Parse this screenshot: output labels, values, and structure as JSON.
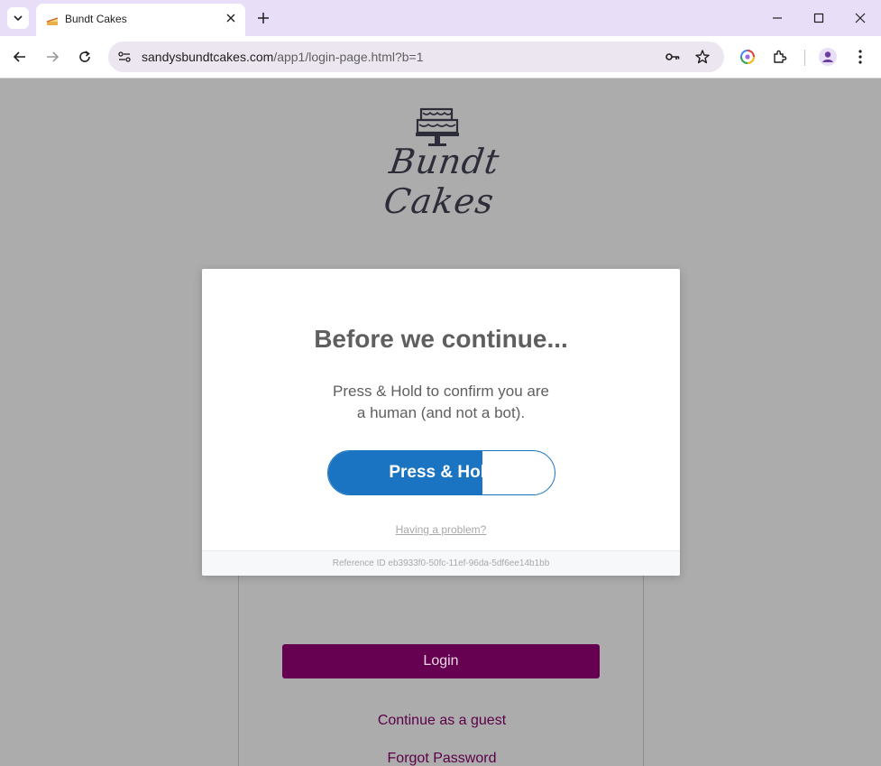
{
  "browser": {
    "tab": {
      "title": "Bundt Cakes"
    },
    "url": {
      "host": "sandysbundtcakes.com",
      "path": "/app1/login-page.html?b=1"
    }
  },
  "page": {
    "logo_text": "Bundt Cakes",
    "login_button": "Login",
    "guest_link": "Continue as a guest",
    "forgot_link": "Forgot Password"
  },
  "modal": {
    "title": "Before we continue...",
    "description_line1": "Press & Hold to confirm you are",
    "description_line2": "a human (and not a bot).",
    "hold_button": "Press & Hold",
    "hold_progress": 0.68,
    "problem_link": "Having a problem?",
    "reference": "Reference ID eb3933f0-50fc-11ef-96da-5df6ee14b1bb"
  },
  "colors": {
    "tabbar_bg": "#e8def8",
    "hold_blue": "#1b74c1",
    "login_purple": "#660050",
    "page_bg": "#acacac"
  }
}
